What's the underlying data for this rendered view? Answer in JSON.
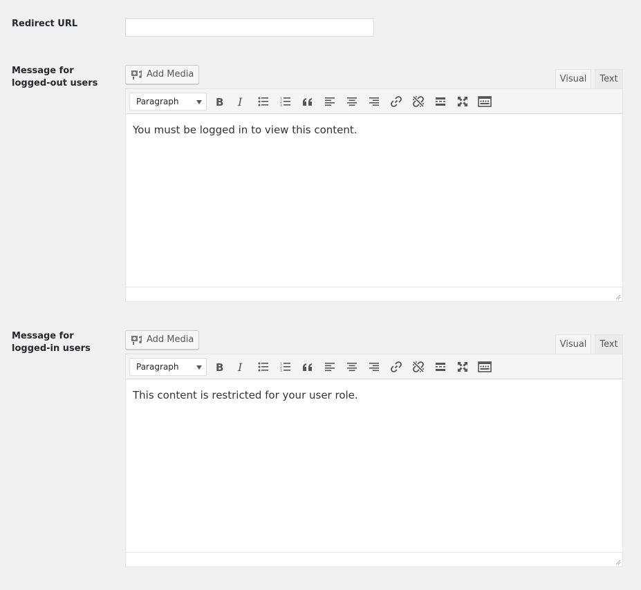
{
  "redirect": {
    "label": "Redirect URL",
    "value": "",
    "placeholder": ""
  },
  "editors": [
    {
      "label": "Message for logged-out users",
      "add_media": "Add Media",
      "tabs": {
        "visual": "Visual",
        "text": "Text",
        "active": "visual"
      },
      "format": "Paragraph",
      "content": "You must be logged in to view this content."
    },
    {
      "label": "Message for logged-in users",
      "add_media": "Add Media",
      "tabs": {
        "visual": "Visual",
        "text": "Text",
        "active": "visual"
      },
      "format": "Paragraph",
      "content": "This content is restricted for your user role."
    }
  ],
  "toolbar_icons": [
    "bold-icon",
    "italic-icon",
    "bullet-list-icon",
    "numbered-list-icon",
    "blockquote-icon",
    "align-left-icon",
    "align-center-icon",
    "align-right-icon",
    "link-icon",
    "unlink-icon",
    "read-more-icon",
    "fullscreen-icon",
    "toolbar-toggle-icon"
  ],
  "colors": {
    "background": "#f1f1f1",
    "icon": "#555555",
    "border": "#dddddd"
  }
}
